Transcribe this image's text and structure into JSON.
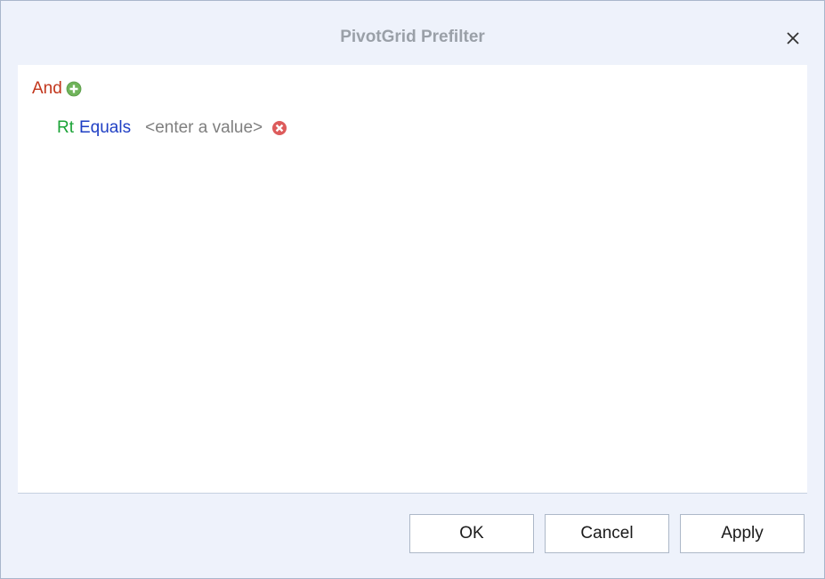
{
  "window": {
    "title": "PivotGrid Prefilter"
  },
  "filter": {
    "group_operator": "And",
    "conditions": [
      {
        "field": "Rt",
        "operator": "Equals",
        "value_placeholder": "<enter a value>"
      }
    ]
  },
  "footer": {
    "ok_label": "OK",
    "cancel_label": "Cancel",
    "apply_label": "Apply"
  },
  "colors": {
    "group_operator": "#c2361c",
    "field": "#1ba336",
    "operator": "#1f3fc4",
    "value_placeholder": "#7f7f7f",
    "add_icon": "#6fb35a",
    "remove_icon": "#dd5b5b"
  },
  "icons": {
    "close": "close-icon",
    "add_condition": "plus-circle-icon",
    "remove_condition": "remove-circle-icon"
  }
}
